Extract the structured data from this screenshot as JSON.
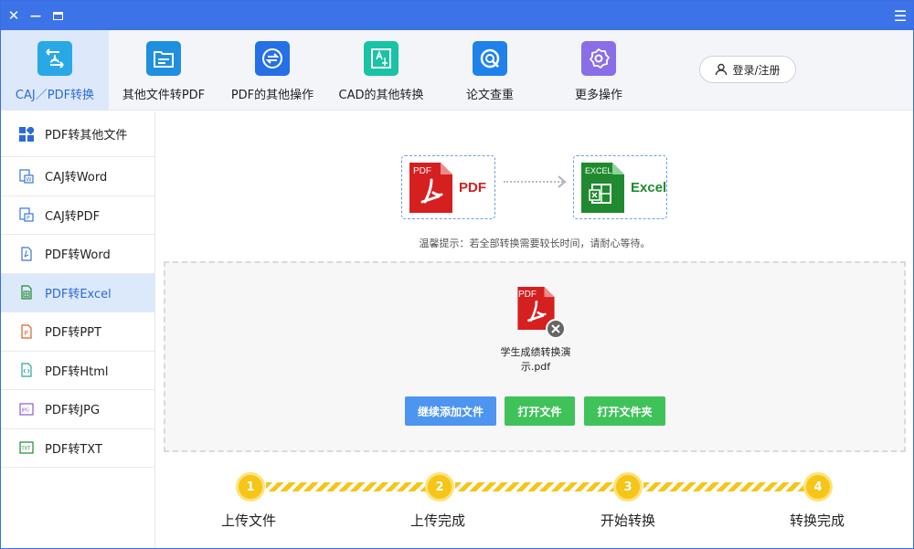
{
  "window": {
    "close_glyph": "✕",
    "minimize_glyph": "—",
    "restore_glyph": "▭",
    "menu_glyph": "☰"
  },
  "toolbar": {
    "items": [
      {
        "label": "CAJ／PDF转换",
        "icon": "caj-pdf-convert-icon",
        "color": "#29a8e6",
        "active": true
      },
      {
        "label": "其他文件转PDF",
        "icon": "file-to-pdf-icon",
        "color": "#1f8fe0",
        "active": false
      },
      {
        "label": "PDF的其他操作",
        "icon": "pdf-operations-icon",
        "color": "#2670e6",
        "active": false
      },
      {
        "label": "CAD的其他转换",
        "icon": "cad-convert-icon",
        "color": "#19c3a5",
        "active": false
      },
      {
        "label": "论文查重",
        "icon": "paper-check-icon",
        "color": "#1e82ea",
        "active": false
      },
      {
        "label": "更多操作",
        "icon": "more-settings-icon",
        "color": "#8a6ee8",
        "active": false
      }
    ],
    "login_label": "登录/注册"
  },
  "sidebar": {
    "items": [
      {
        "label": "PDF转其他文件",
        "icon": "grid-icon"
      },
      {
        "label": "CAJ转Word",
        "icon": "caj-word-icon"
      },
      {
        "label": "CAJ转PDF",
        "icon": "caj-pdf-icon"
      },
      {
        "label": "PDF转Word",
        "icon": "pdf-word-icon"
      },
      {
        "label": "PDF转Excel",
        "icon": "pdf-excel-icon",
        "active": true
      },
      {
        "label": "PDF转PPT",
        "icon": "pdf-ppt-icon"
      },
      {
        "label": "PDF转Html",
        "icon": "pdf-html-icon"
      },
      {
        "label": "PDF转JPG",
        "icon": "pdf-jpg-icon"
      },
      {
        "label": "PDF转TXT",
        "icon": "pdf-txt-icon"
      }
    ]
  },
  "conversion": {
    "from_tag": "PDF",
    "from_label": "PDF",
    "from_color": "#d61f1f",
    "to_tag": "EXCEL",
    "to_label": "Excel",
    "to_color": "#1f8a2f",
    "tip": "温馨提示：若全部转换需要较长时间，请耐心等待。"
  },
  "dropzone": {
    "file_tag": "PDF",
    "file_name_line1": "学生成绩转换演",
    "file_name_line2": "示.pdf",
    "buttons": {
      "add": "继续添加文件",
      "open_file": "打开文件",
      "open_folder": "打开文件夹"
    }
  },
  "steps": [
    {
      "num": "1",
      "label": "上传文件"
    },
    {
      "num": "2",
      "label": "上传完成"
    },
    {
      "num": "3",
      "label": "开始转换"
    },
    {
      "num": "4",
      "label": "转换完成"
    }
  ]
}
